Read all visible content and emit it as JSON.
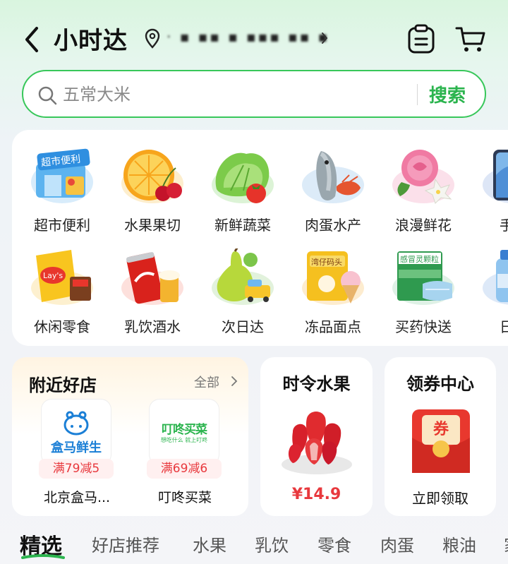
{
  "header": {
    "title": "小时达",
    "address": "· ▪ ▪▪ ▪ ▪▪▪ ▪▪ ▪"
  },
  "search": {
    "placeholder": "五常大米",
    "button_label": "搜索"
  },
  "categories": [
    {
      "label": "超市便利",
      "icon": "supermarket-icon"
    },
    {
      "label": "水果果切",
      "icon": "orange-cherry-icon"
    },
    {
      "label": "新鲜蔬菜",
      "icon": "vegetables-icon"
    },
    {
      "label": "肉蛋水产",
      "icon": "fish-shrimp-icon"
    },
    {
      "label": "浪漫鲜花",
      "icon": "rose-icon"
    },
    {
      "label": "手机",
      "icon": "phone-icon"
    },
    {
      "label": "休闲零食",
      "icon": "snacks-icon"
    },
    {
      "label": "乳饮酒水",
      "icon": "cola-beer-icon"
    },
    {
      "label": "次日达",
      "icon": "pear-truck-icon"
    },
    {
      "label": "冻品面点",
      "icon": "frozen-icecream-icon"
    },
    {
      "label": "买药快送",
      "icon": "medicine-icon"
    },
    {
      "label": "日用",
      "icon": "daily-bottle-icon"
    }
  ],
  "nearby": {
    "title": "附近好店",
    "all_label": "全部",
    "stores": [
      {
        "logo_text": "盒马鲜生",
        "badge": "满79减5",
        "name": "北京盒马..."
      },
      {
        "logo_text": "叮咚买菜",
        "logo_subtext": "想吃什么 就上叮咚",
        "badge": "满69减6",
        "name": "叮咚买菜"
      }
    ]
  },
  "fruit_card": {
    "title": "时令水果",
    "price": "¥14.9"
  },
  "coupon_card": {
    "title": "领券中心",
    "coupon_glyph": "券",
    "action_label": "立即领取"
  },
  "tabs": [
    "精选",
    "好店推荐",
    "水果",
    "乳饮",
    "零食",
    "肉蛋",
    "粮油",
    "家"
  ],
  "colors": {
    "brand_green": "#2bb44e",
    "price_red": "#e8383d"
  }
}
